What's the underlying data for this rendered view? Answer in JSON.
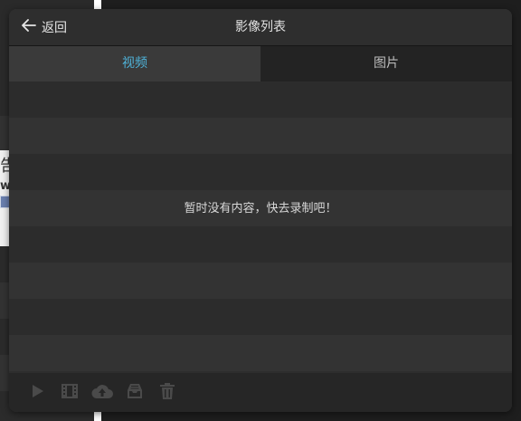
{
  "background_app": {
    "fragment_char": "告",
    "fragment_letter": "w"
  },
  "dialog": {
    "back_label": "返回",
    "title": "影像列表"
  },
  "tabs": [
    {
      "label": "视频",
      "active": true
    },
    {
      "label": "图片",
      "active": false
    }
  ],
  "list": {
    "empty_message": "暂时没有内容，快去录制吧！"
  },
  "toolbar": {
    "icons": [
      "play-icon",
      "film-icon",
      "cloud-upload-icon",
      "inbox-icon",
      "trash-icon"
    ]
  },
  "colors": {
    "accent": "#4fb3d9",
    "icon_disabled": "#4a4a4a"
  }
}
